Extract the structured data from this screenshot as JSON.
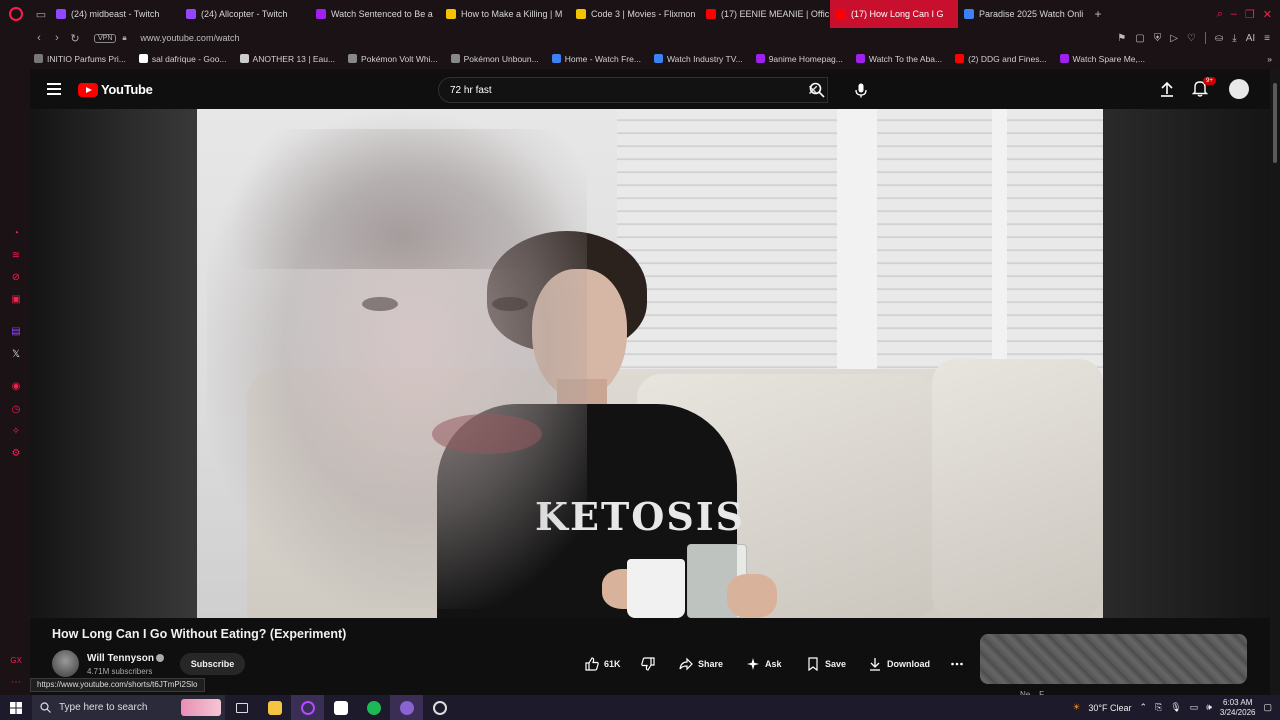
{
  "browser": {
    "tabs": [
      {
        "title": "(24) midbeast - Twitch",
        "color": "#9146ff"
      },
      {
        "title": "(24) Allcopter - Twitch",
        "color": "#9146ff"
      },
      {
        "title": "Watch Sentenced to Be a",
        "color": "#a020f0"
      },
      {
        "title": "How to Make a Killing | M",
        "color": "#f5c400"
      },
      {
        "title": "Code 3 | Movies - Flixmon",
        "color": "#f5c400"
      },
      {
        "title": "(17) EENIE MEANIE | Offic",
        "color": "#ff0000"
      },
      {
        "title": "(17) How Long Can I G",
        "color": "#ff0000",
        "active": true
      },
      {
        "title": "Paradise 2025 Watch Onli",
        "color": "#3b82f6"
      }
    ],
    "url": "www.youtube.com/watch",
    "vpn_label": "VPN",
    "bookmarks": [
      {
        "label": "INITIO Parfums Pri...",
        "color": "#777"
      },
      {
        "label": "sal dafrique - Goo...",
        "color": "#ffffff"
      },
      {
        "label": "ANOTHER 13 | Eau...",
        "color": "#cccccc"
      },
      {
        "label": "Pokémon Volt Whi...",
        "color": "#888"
      },
      {
        "label": "Pokémon Unboun...",
        "color": "#888"
      },
      {
        "label": "Home - Watch Fre...",
        "color": "#3b82f6"
      },
      {
        "label": "Watch Industry TV...",
        "color": "#3b82f6"
      },
      {
        "label": "9anime Homepag...",
        "color": "#a020f0"
      },
      {
        "label": "Watch To the Aba...",
        "color": "#a020f0"
      },
      {
        "label": "(2) DDG and Fines...",
        "color": "#ff0000"
      },
      {
        "label": "Watch Spare Me,...",
        "color": "#a020f0"
      }
    ],
    "addr_ai_label": "AI"
  },
  "youtube": {
    "logo_text": "YouTube",
    "search_query": "72 hr fast",
    "notification_badge": "9+",
    "video_title": "How Long Can I Go Without Eating? (Experiment)",
    "channel_name": "Will Tennyson",
    "subscribers": "4.71M subscribers",
    "subscribe_label": "Subscribe",
    "likes": "61K",
    "share_label": "Share",
    "ask_label": "Ask",
    "save_label": "Save",
    "download_label": "Download",
    "shirt_text": "KETOSIS",
    "hover_link": "https://www.youtube.com/shorts/t6JTmPi2Slo",
    "ad_snippet": "Ne... F..."
  },
  "taskbar": {
    "search_placeholder": "Type here to search",
    "weather": "30°F  Clear",
    "time": "6:03 AM",
    "date": "3/24/2026"
  },
  "colors": {
    "opera_accent": "#fa1e4e",
    "youtube_red": "#ff0000",
    "active_tab": "#c8102e"
  }
}
